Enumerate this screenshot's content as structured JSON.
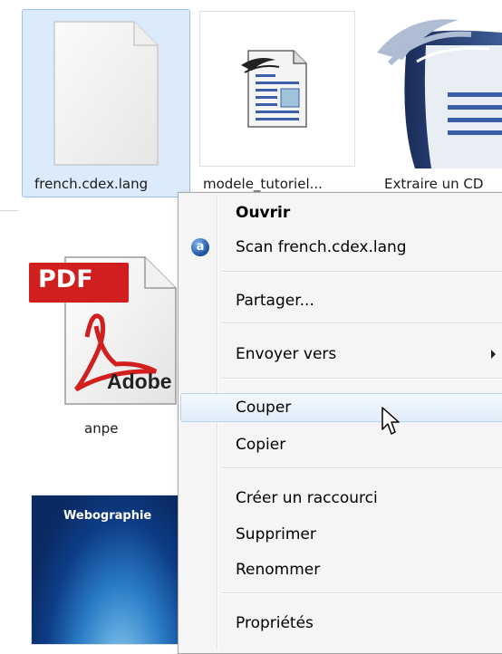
{
  "files": [
    {
      "name": "french.cdex.lang",
      "icon": "blank-file-icon",
      "selected": true
    },
    {
      "name": "modele_tutoriel...",
      "icon": "openoffice-writer-icon",
      "selected": false
    },
    {
      "name": "Extraire un CD",
      "icon": "openoffice-document-icon",
      "selected": false
    },
    {
      "name": "anpe",
      "icon": "pdf-icon",
      "selected": false
    },
    {
      "name": "Webographie",
      "icon": "webographie-thumbnail",
      "selected": false
    }
  ],
  "pdf_icon": {
    "banner": "PDF",
    "brand": "Adobe"
  },
  "context_menu": {
    "items": [
      {
        "label": "Ouvrir",
        "bold": true
      },
      {
        "label": "Scan french.cdex.lang",
        "icon": "scan-a-icon",
        "icon_text": "a"
      },
      {
        "label": "Partager..."
      },
      {
        "label": "Envoyer vers",
        "submenu": true
      },
      {
        "label": "Couper",
        "hover": true
      },
      {
        "label": "Copier"
      },
      {
        "label": "Créer un raccourci"
      },
      {
        "label": "Supprimer"
      },
      {
        "label": "Renommer"
      },
      {
        "label": "Propriétés"
      }
    ]
  },
  "colors": {
    "selection": "#dcebfb",
    "menu_background": "#f5f5f5",
    "pdf_red": "#d11f1f"
  }
}
